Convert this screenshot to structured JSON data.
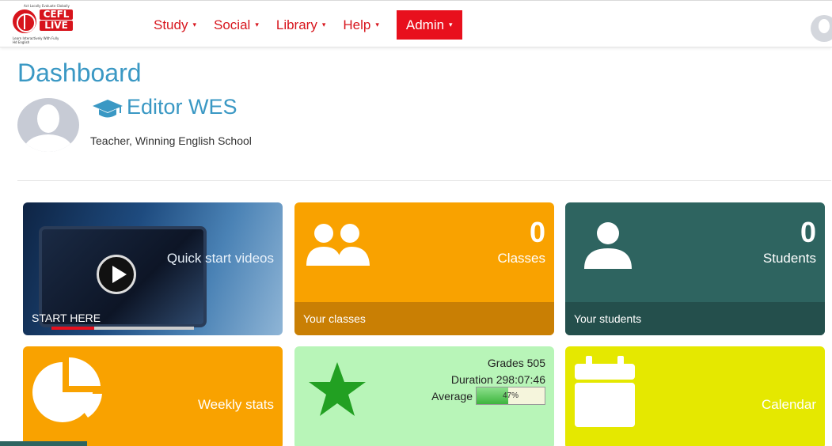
{
  "brand": {
    "tagline": "Act Locally Evaluate Globally",
    "word_top": "CEFL",
    "word_bottom": "LIVE",
    "subtitle": "Learn Interactively With Fully Hd English",
    "color": "#d7141c"
  },
  "nav": {
    "items": [
      {
        "label": "Study",
        "caret": "▾"
      },
      {
        "label": "Social",
        "caret": "▾"
      },
      {
        "label": "Library",
        "caret": "▾"
      },
      {
        "label": "Help",
        "caret": "▾"
      }
    ],
    "admin": {
      "label": "Admin",
      "caret": "▾"
    },
    "accent": "#e8101d"
  },
  "header": {
    "title": "Dashboard",
    "user_name": "Editor WES",
    "user_role": "Teacher, Winning English School",
    "title_color": "#3a98c4"
  },
  "tiles": {
    "video": {
      "label": "Quick start videos",
      "footer": "START HERE"
    },
    "classes": {
      "count": "0",
      "label": "Classes",
      "footer": "Your classes",
      "color": "#f9a200"
    },
    "students": {
      "count": "0",
      "label": "Students",
      "footer": "Your students",
      "color": "#2e6460"
    },
    "stats": {
      "label": "Weekly stats",
      "color": "#f9a200"
    },
    "grades": {
      "grades": "Grades 505",
      "duration": "Duration 298:07:46",
      "average_label": "Average",
      "average_text": "47%",
      "average_value": 0.47,
      "color": "#b8f5b8"
    },
    "calendar": {
      "label": "Calendar",
      "color": "#e5e800"
    }
  },
  "icons": {
    "user_cap": "graduation-cap-icon",
    "classes": "users-icon",
    "students": "user-icon",
    "stats": "pie-chart-icon",
    "grades": "star-icon",
    "calendar": "calendar-icon",
    "video": "play-icon"
  }
}
